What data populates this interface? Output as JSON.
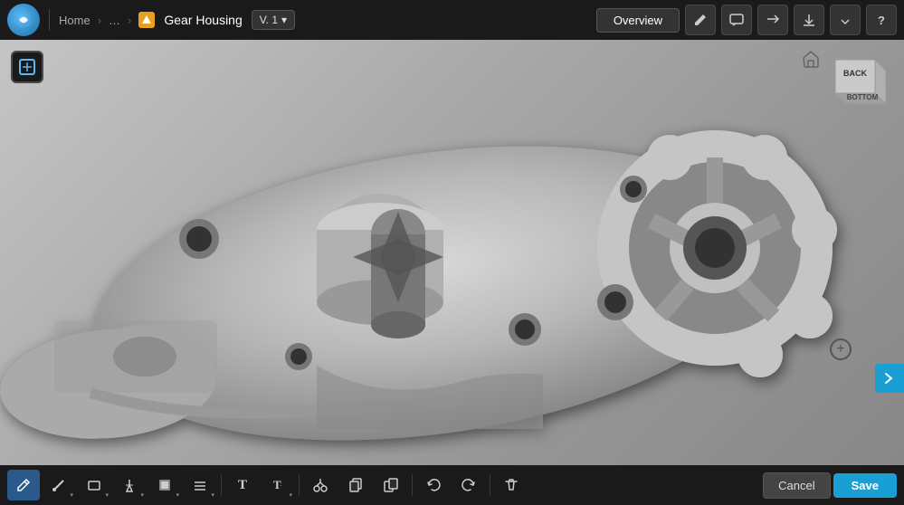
{
  "topbar": {
    "home_label": "Home",
    "breadcrumb_sep1": "›",
    "breadcrumb_ellipsis": "…",
    "breadcrumb_sep2": "›",
    "document_title": "Gear Housing",
    "version_label": "V. 1",
    "version_arrow": "▾",
    "overview_label": "Overview",
    "edit_icon": "✏",
    "comment_icon": "💬",
    "share_icon": "⇗",
    "download_icon": "⬇",
    "more_icon": "▾",
    "help_icon": "?"
  },
  "canvas": {
    "cube_back_label": "BACK",
    "cube_bottom_label": "BOTTOM",
    "home_icon": "⌂",
    "side_arrow": "›"
  },
  "bottombar": {
    "tools": [
      {
        "id": "sketch",
        "icon": "✏",
        "active": true,
        "has_arrow": false
      },
      {
        "id": "line",
        "icon": "╱",
        "active": false,
        "has_arrow": true
      },
      {
        "id": "rect",
        "icon": "▭",
        "active": false,
        "has_arrow": true
      },
      {
        "id": "point",
        "icon": "⊹",
        "active": false,
        "has_arrow": true
      },
      {
        "id": "fill",
        "icon": "▪",
        "active": false,
        "has_arrow": true
      },
      {
        "id": "hatch",
        "icon": "≡",
        "active": false,
        "has_arrow": true
      },
      {
        "id": "text",
        "icon": "T",
        "active": false,
        "has_arrow": false
      },
      {
        "id": "text2",
        "icon": "T.",
        "active": false,
        "has_arrow": true
      },
      {
        "id": "scissors",
        "icon": "✂",
        "active": false,
        "has_arrow": false
      },
      {
        "id": "copy",
        "icon": "❒",
        "active": false,
        "has_arrow": false
      },
      {
        "id": "paste",
        "icon": "❏",
        "active": false,
        "has_arrow": false
      },
      {
        "id": "undo",
        "icon": "↩",
        "active": false,
        "has_arrow": false
      },
      {
        "id": "redo",
        "icon": "↪",
        "active": false,
        "has_arrow": false
      },
      {
        "id": "delete",
        "icon": "🗑",
        "active": false,
        "has_arrow": false
      }
    ],
    "cancel_label": "Cancel",
    "save_label": "Save"
  },
  "colors": {
    "accent": "#1a9fd4",
    "topbar_bg": "#1a1a1a",
    "canvas_bg": "#b0b0b0",
    "active_tool": "#2a5a8c"
  }
}
